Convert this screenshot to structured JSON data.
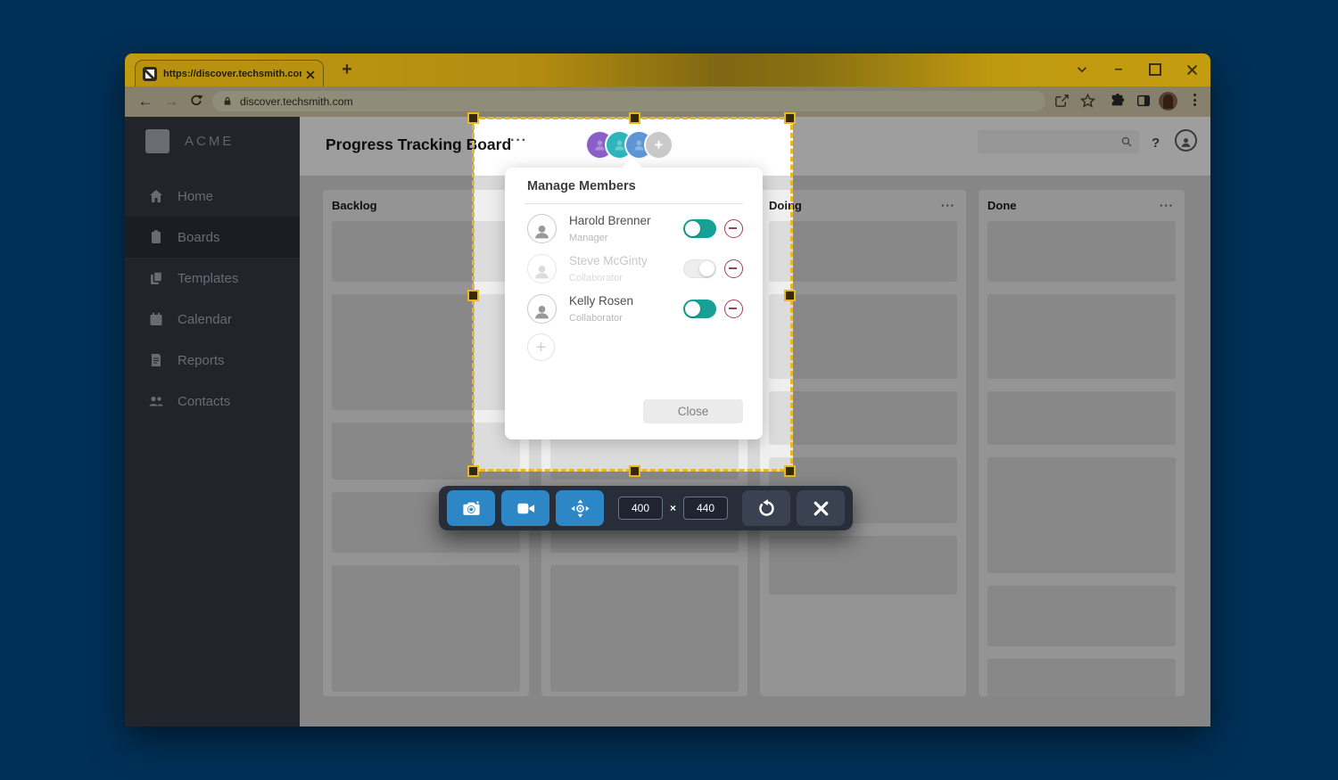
{
  "browser": {
    "tab_title": "https://discover.techsmith.com",
    "new_tab_label": "+",
    "url": "discover.techsmith.com"
  },
  "app": {
    "sidebar": {
      "logo_text": "ACME",
      "items": [
        {
          "label": "Home",
          "icon": "home-icon",
          "active": false
        },
        {
          "label": "Boards",
          "icon": "boards-icon",
          "active": true
        },
        {
          "label": "Templates",
          "icon": "templates-icon",
          "active": false
        },
        {
          "label": "Calendar",
          "icon": "calendar-icon",
          "active": false
        },
        {
          "label": "Reports",
          "icon": "reports-icon",
          "active": false
        },
        {
          "label": "Contacts",
          "icon": "contacts-icon",
          "active": false
        }
      ]
    },
    "header": {
      "title": "Progress Tracking Board",
      "menu_dots": "···",
      "avatar_add_label": "+",
      "help_label": "?"
    },
    "board": {
      "menu_dots": "···",
      "columns": [
        {
          "label": "Backlog",
          "show_menu": false,
          "card_heights": [
            68,
            130,
            64,
            68,
            142
          ]
        },
        {
          "label": "",
          "show_menu": false,
          "card_heights": [
            68,
            130,
            64,
            68,
            142
          ]
        },
        {
          "label": "Doing",
          "show_menu": true,
          "card_heights": [
            68,
            95,
            60,
            74,
            66
          ]
        },
        {
          "label": "Done",
          "show_menu": true,
          "card_heights": [
            68,
            95,
            60,
            130,
            68,
            60
          ]
        }
      ]
    }
  },
  "popup": {
    "title": "Manage Members",
    "members": [
      {
        "name": "Harold Brenner",
        "role": "Manager",
        "enabled": true,
        "faded": false
      },
      {
        "name": "Steve McGinty",
        "role": "Collaborator",
        "enabled": false,
        "faded": true
      },
      {
        "name": "Kelly Rosen",
        "role": "Collaborator",
        "enabled": true,
        "faded": false
      }
    ],
    "add_label": "+",
    "close_label": "Close"
  },
  "capture": {
    "width_value": "400",
    "separator": "×",
    "height_value": "440"
  },
  "colors": {
    "navy_background": "#003057",
    "chrome_gold": "#b5900e",
    "selection_gold": "#eab71e",
    "toolbar_blue": "#2d86c6",
    "toggle_on_teal": "#17a096",
    "remove_maroon": "#9b4054",
    "avatar_purple": "#8a5fc7",
    "avatar_teal": "#2eb4bc",
    "avatar_blue": "#5d95d6"
  }
}
